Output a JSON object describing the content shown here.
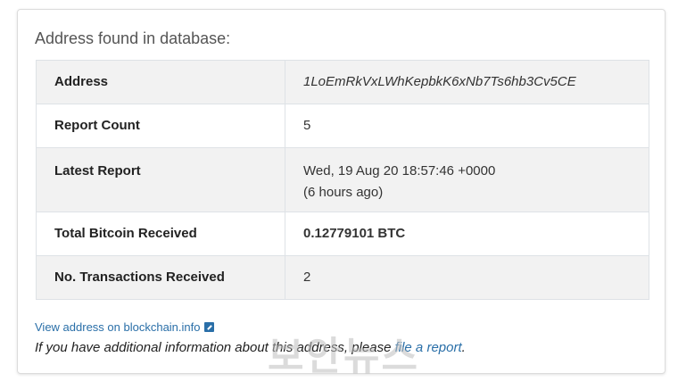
{
  "heading": "Address found in database:",
  "rows": [
    {
      "key": "Address",
      "value": "1LoEmRkVxLWhKepbkK6xNb7Ts6hb3Cv5CE"
    },
    {
      "key": "Report Count",
      "value": "5"
    },
    {
      "key": "Latest Report",
      "value": "Wed, 19 Aug 20 18:57:46 +0000",
      "value2": "(6 hours ago)"
    },
    {
      "key": "Total Bitcoin Received",
      "value": "0.12779101 BTC"
    },
    {
      "key": "No. Transactions Received",
      "value": "2"
    }
  ],
  "links": {
    "blockchain": "View address on blockchain.info",
    "note_prefix": "If you have additional information about this address, please ",
    "report": "file a report",
    "note_suffix": "."
  },
  "watermark": "보안뉴스",
  "colors": {
    "link": "#2a6fa8",
    "row_shade": "#f2f2f2",
    "border": "#dee2e6"
  }
}
